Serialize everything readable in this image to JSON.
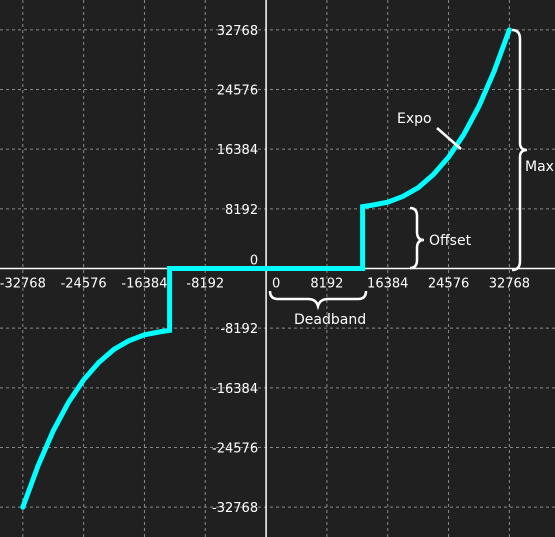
{
  "chart_data": {
    "type": "line",
    "title": "",
    "xlabel": "",
    "ylabel": "",
    "xlim": [
      -35840,
      38912
    ],
    "ylim": [
      -36864,
      36864
    ],
    "grid": true,
    "x_ticks": [
      {
        "value": -32768,
        "label": "-32768"
      },
      {
        "value": -24576,
        "label": "-24576"
      },
      {
        "value": -16384,
        "label": "-16384"
      },
      {
        "value": -8192,
        "label": "-8192"
      },
      {
        "value": 0,
        "label": "0"
      },
      {
        "value": 8192,
        "label": "8192"
      },
      {
        "value": 16384,
        "label": "16384"
      },
      {
        "value": 24576,
        "label": "24576"
      },
      {
        "value": 32768,
        "label": "32768"
      }
    ],
    "y_ticks": [
      {
        "value": 32768,
        "label": "32768"
      },
      {
        "value": 24576,
        "label": "24576"
      },
      {
        "value": 16384,
        "label": "16384"
      },
      {
        "value": 8192,
        "label": "8192"
      },
      {
        "value": 0,
        "label": "0"
      },
      {
        "value": -8192,
        "label": "-8192"
      },
      {
        "value": -16384,
        "label": "-16384"
      },
      {
        "value": -24576,
        "label": "-24576"
      },
      {
        "value": -32768,
        "label": "-32768"
      }
    ],
    "series": [
      {
        "color": "#00ffff",
        "x": [
          -32768,
          -30720,
          -28672,
          -26624,
          -24576,
          -22528,
          -20480,
          -18432,
          -16384,
          -14336,
          -13000,
          -13000,
          13000,
          13000,
          14336,
          16384,
          18432,
          20480,
          22528,
          24576,
          26624,
          28672,
          30720,
          32768
        ],
        "y": [
          -32768,
          -27100,
          -22300,
          -18400,
          -15300,
          -12900,
          -11100,
          -9900,
          -9100,
          -8700,
          -8500,
          0,
          0,
          8500,
          8700,
          9100,
          9900,
          11100,
          12900,
          15300,
          18400,
          22300,
          27100,
          32768
        ]
      }
    ],
    "annotations": {
      "deadband": "Deadband",
      "offset": "Offset",
      "expo": "Expo",
      "max": "Max"
    }
  }
}
